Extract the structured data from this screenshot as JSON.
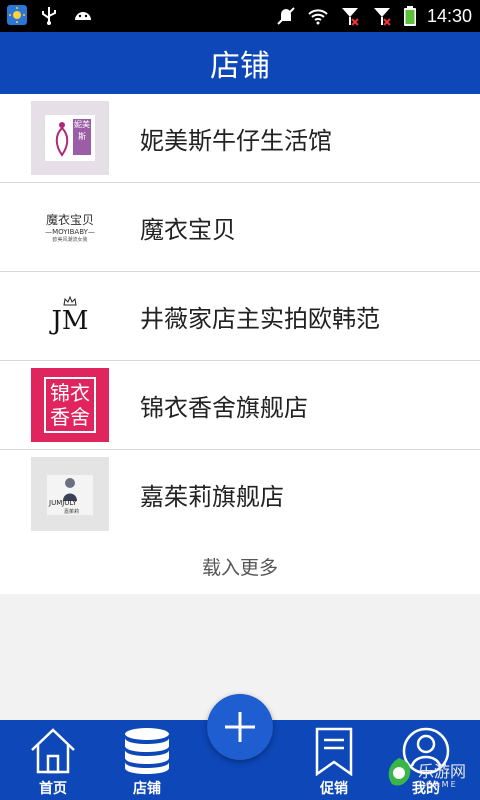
{
  "status_bar": {
    "time": "14:30"
  },
  "header": {
    "title": "店铺"
  },
  "stores": [
    {
      "name": "妮美斯牛仔生活馆",
      "logo_text": "妮美斯"
    },
    {
      "name": "魔衣宝贝",
      "logo_text": "魔衣宝贝",
      "logo_sub": "—MOYIBABY—",
      "logo_small": "欧美风潮流女装"
    },
    {
      "name": "井薇家店主实拍欧韩范",
      "logo_text": "JM"
    },
    {
      "name": "锦衣香舍旗舰店",
      "logo_line1": "锦衣",
      "logo_line2": "香舍"
    },
    {
      "name": "嘉茱莉旗舰店",
      "logo_text": "JUMJULY",
      "logo_small": "嘉茱莉"
    }
  ],
  "load_more": "载入更多",
  "tabs": [
    {
      "label": "首页",
      "icon": "home-icon"
    },
    {
      "label": "店铺",
      "icon": "database-icon"
    },
    {
      "label": "促销",
      "icon": "bookmark-icon"
    },
    {
      "label": "我的",
      "icon": "user-icon"
    }
  ],
  "fab": {
    "icon": "plus-icon"
  },
  "watermark": {
    "text": "乐游网",
    "sub": "GAME"
  },
  "colors": {
    "primary": "#0d47b8",
    "fab": "#1e5ed0",
    "accent_pink": "#e0245e",
    "lavender": "#9b5ea6"
  }
}
